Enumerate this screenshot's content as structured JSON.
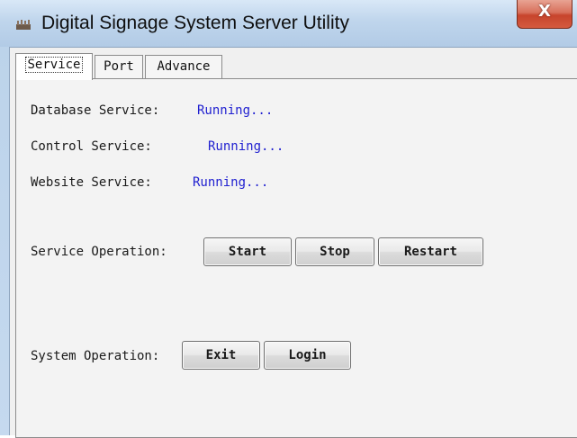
{
  "window": {
    "title": "Digital Signage System Server Utility",
    "close_glyph": "X"
  },
  "tabs": [
    {
      "label": "Service",
      "active": true
    },
    {
      "label": "Port",
      "active": false
    },
    {
      "label": "Advance",
      "active": false
    }
  ],
  "services": [
    {
      "label": "Database Service:",
      "status": "Running..."
    },
    {
      "label": "Control Service:",
      "status": "Running..."
    },
    {
      "label": "Website Service:",
      "status": "Running..."
    }
  ],
  "service_operation": {
    "label": "Service Operation:",
    "buttons": [
      "Start",
      "Stop",
      "Restart"
    ]
  },
  "system_operation": {
    "label": "System Operation:",
    "buttons": [
      "Exit",
      "Login"
    ]
  },
  "colors": {
    "status_text": "#1f1fd0",
    "close_button": "#c7442c"
  }
}
